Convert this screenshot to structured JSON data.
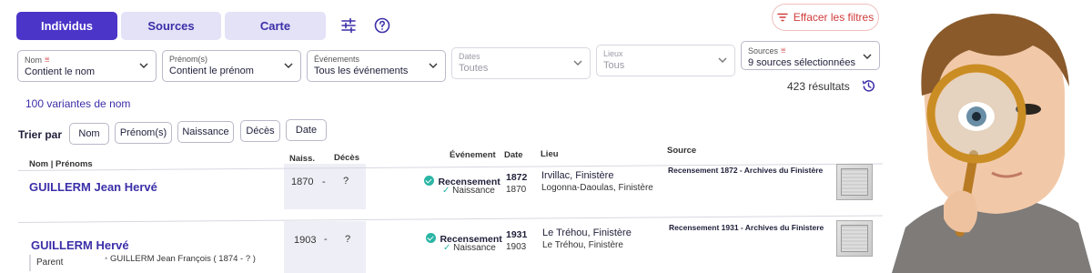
{
  "tabs": [
    {
      "label": "Individus",
      "active": true
    },
    {
      "label": "Sources",
      "active": false
    },
    {
      "label": "Carte",
      "active": false
    }
  ],
  "toolbar": {
    "settings_icon": "sliders-icon",
    "help_icon": "help-circle-icon"
  },
  "clear_filters": {
    "label": "Effacer les filtres",
    "icon": "filter-lines-icon",
    "color": "#d13a3a"
  },
  "filters": [
    {
      "label": "Nom",
      "value": "Contient le nom",
      "has_funnel": true
    },
    {
      "label": "Prénom(s)",
      "value": "Contient le prénom",
      "has_funnel": false
    },
    {
      "label": "Événements",
      "value": "Tous les événements",
      "has_funnel": false
    },
    {
      "label": "Dates",
      "value": "Toutes",
      "has_funnel": false,
      "disabled": true
    },
    {
      "label": "Lieux",
      "value": "Tous",
      "has_funnel": false,
      "disabled": true
    },
    {
      "label": "Sources",
      "value": "9 sources sélectionnées",
      "has_funnel": true
    }
  ],
  "variants_link": "100 variantes de nom",
  "results_count": "423 résultats",
  "sort": {
    "label": "Trier par",
    "buttons": [
      "Nom",
      "Prénom(s)",
      "Naissance",
      "Décès",
      "Date"
    ]
  },
  "columns": {
    "name": "Nom | Prénoms",
    "birth": "Naiss.",
    "death": "Décès",
    "event": "Événement",
    "date": "Date",
    "place": "Lieu",
    "source": "Source"
  },
  "rows": [
    {
      "name": "GUILLERM Jean Hervé",
      "birth": "1870",
      "sep": "-",
      "death": "?",
      "event_main": "Recensement",
      "event_sub": "Naissance",
      "date_main": "1872",
      "date_sub": "1870",
      "place_main": "Irvillac, Finistère",
      "place_sub": "Logonna-Daoulas, Finistère",
      "source": "Recensement 1872 - Archives du Finistère"
    },
    {
      "name": "GUILLERM Hervé",
      "birth": "1903",
      "sep": "-",
      "death": "?",
      "event_main": "Recensement",
      "event_sub": "Naissance",
      "date_main": "1931",
      "date_sub": "1903",
      "place_main": "Le Tréhou, Finistère",
      "place_sub": "Le Tréhou, Finistère",
      "source": "Recensement 1931 - Archives du Finistere",
      "relation_label": "Parent",
      "relation_value": "GUILLERM Jean François ( 1874 - ? )"
    }
  ],
  "colors": {
    "accent": "#4a35c8",
    "accent_light": "#e3e2f7",
    "teal": "#2bb5a5"
  }
}
